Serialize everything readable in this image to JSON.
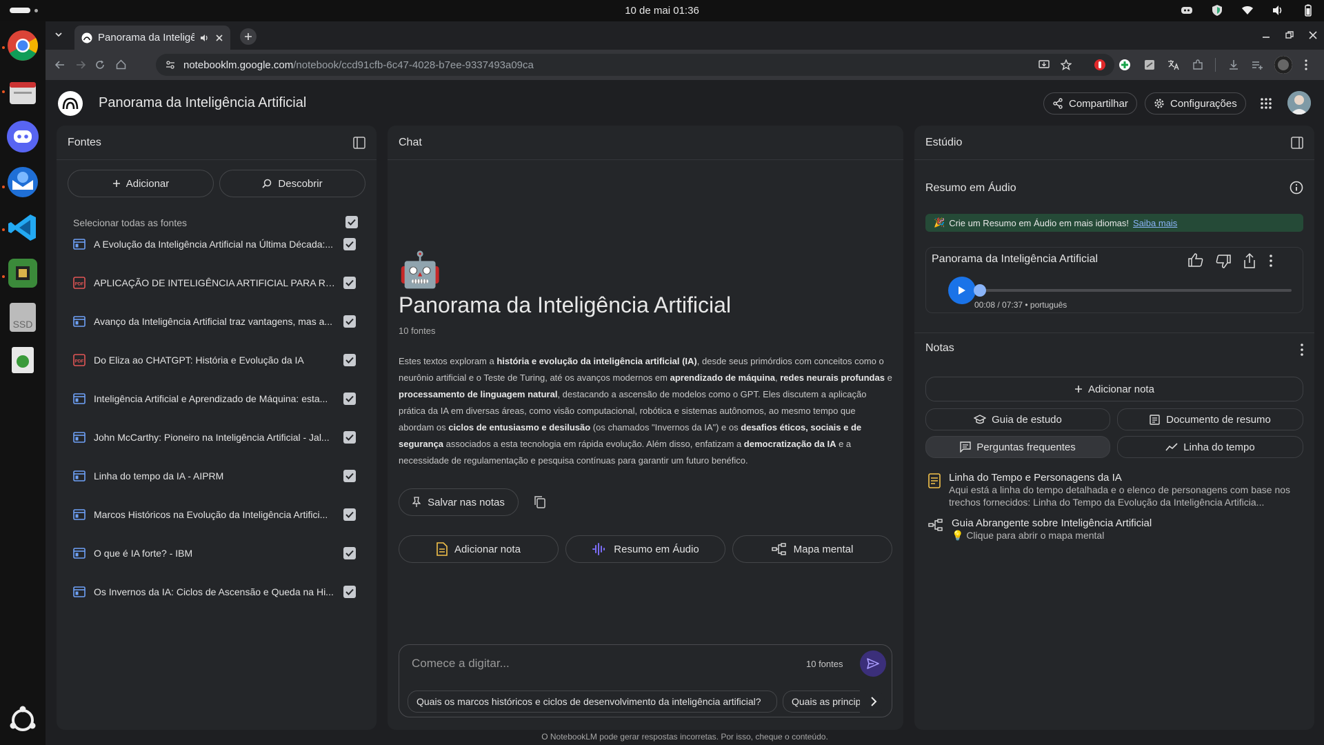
{
  "os": {
    "clock": "10 de mai  01:36"
  },
  "browser": {
    "tab_title": "Panorama da Inteligência Artificial",
    "url_host": "notebooklm.google.com",
    "url_path": "/notebook/ccd91cfb-6c47-4028-b7ee-9337493a09ca"
  },
  "app": {
    "title": "Panorama da Inteligência Artificial",
    "share_label": "Compartilhar",
    "settings_label": "Configurações"
  },
  "sources": {
    "header": "Fontes",
    "add_label": "Adicionar",
    "discover_label": "Descobrir",
    "select_all_label": "Selecionar todas as fontes",
    "items": [
      {
        "name": "A Evolução da Inteligência Artificial na Última Década:...",
        "type": "web"
      },
      {
        "name": "APLICAÇÃO DE INTELIGÊNCIA ARTIFICIAL PARA ROB...",
        "type": "pdf"
      },
      {
        "name": "Avanço da Inteligência Artificial traz vantagens, mas a...",
        "type": "web"
      },
      {
        "name": "Do Eliza ao CHATGPT: História e Evolução da IA",
        "type": "pdf"
      },
      {
        "name": "Inteligência Artificial e Aprendizado de Máquina: esta...",
        "type": "web"
      },
      {
        "name": "John McCarthy: Pioneiro na Inteligência Artificial - Jal...",
        "type": "web"
      },
      {
        "name": "Linha do tempo da IA - AIPRM",
        "type": "web"
      },
      {
        "name": "Marcos Históricos na Evolução da Inteligência Artifici...",
        "type": "web"
      },
      {
        "name": "O que é IA forte? - IBM",
        "type": "web"
      },
      {
        "name": "Os Invernos da IA: Ciclos de Ascensão e Queda na Hi...",
        "type": "web"
      }
    ]
  },
  "chat": {
    "header": "Chat",
    "emoji": "🤖",
    "title": "Panorama da Inteligência Artificial",
    "source_count": "10 fontes",
    "summary": {
      "p1": "Estes textos exploram a ",
      "b1": "história e evolução da inteligência artificial (IA)",
      "p2": ", desde seus primórdios com conceitos como o neurônio artificial e o Teste de Turing, até os avanços modernos em ",
      "b2": "aprendizado de máquina",
      "p3": ", ",
      "b3": "redes neurais profundas",
      "p4": " e ",
      "b4": "processamento de linguagem natural",
      "p5": ", destacando a ascensão de modelos como o GPT. Eles discutem a aplicação prática da IA em diversas áreas, como visão computacional, robótica e sistemas autônomos, ao mesmo tempo que abordam os ",
      "b5": "ciclos de entusiasmo e desilusão",
      "p6": " (os chamados \"Invernos da IA\") e os ",
      "b6": "desafios éticos, sociais e de segurança",
      "p7": " associados a esta tecnologia em rápida evolução. Além disso, enfatizam a ",
      "b7": "democratização da IA",
      "p8": " e a necessidade de regulamentação e pesquisa contínuas para garantir um futuro benéfico."
    },
    "save_notes_label": "Salvar nas notas",
    "add_note_label": "Adicionar nota",
    "audio_summary_label": "Resumo em Áudio",
    "mind_map_label": "Mapa mental",
    "input_placeholder": "Comece a digitar...",
    "input_source_count": "10 fontes",
    "suggestions": [
      "Quais os marcos históricos e ciclos de desenvolvimento da inteligência artificial?",
      "Quais as princip"
    ]
  },
  "studio": {
    "header": "Estúdio",
    "audio_section_title": "Resumo em Áudio",
    "banner_text": "Crie um Resumo em Áudio em mais idiomas!",
    "banner_link": "Saiba mais",
    "player_title": "Panorama da Inteligência Artificial",
    "player_time": "00:08 / 07:37 • português",
    "player_progress": 0.017,
    "notes_title": "Notas",
    "add_note_label": "Adicionar nota",
    "study_guide_label": "Guia de estudo",
    "summary_doc_label": "Documento de resumo",
    "faq_label": "Perguntas frequentes",
    "timeline_label": "Linha do tempo",
    "notes": [
      {
        "title": "Linha do Tempo e Personagens da IA",
        "desc": "Aqui está a linha do tempo detalhada e o elenco de personagens com base nos trechos fornecidos: Linha do Tempo da Evolução da Inteligência Artificia...",
        "icon": "note-icon"
      },
      {
        "title": "Guia Abrangente sobre Inteligência Artificial",
        "desc": "💡 Clique para abrir o mapa mental",
        "icon": "mind-map-icon"
      }
    ]
  },
  "footer": "O NotebookLM pode gerar respostas incorretas. Por isso, cheque o conteúdo.",
  "colors": {
    "accent_purple": "#7b6cf6",
    "play_blue": "#1a73e8",
    "banner_green": "#254a37",
    "pdf_red": "#e25555",
    "web_blue": "#6ea1f7"
  }
}
